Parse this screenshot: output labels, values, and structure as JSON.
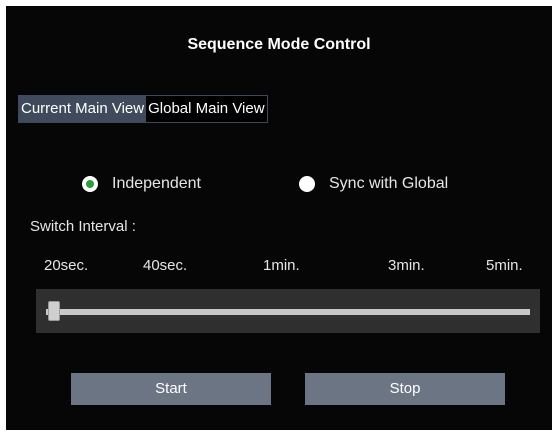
{
  "title": "Sequence Mode Control",
  "tabs": [
    {
      "label": "Current Main View",
      "active": true
    },
    {
      "label": "Global Main View",
      "active": false
    }
  ],
  "mode_options": [
    {
      "label": "Independent",
      "checked": true
    },
    {
      "label": "Sync with Global",
      "checked": false
    }
  ],
  "interval_label": "Switch Interval :",
  "interval_ticks": [
    "20sec.",
    "40sec.",
    "1min.",
    "3min.",
    "5min."
  ],
  "slider": {
    "selected_index": 0,
    "selected_value": "20sec."
  },
  "buttons": {
    "start": "Start",
    "stop": "Stop"
  },
  "colors": {
    "panel_bg": "#060606",
    "active_tab": "#3f4b5c",
    "button_bg": "#6b7584",
    "radio_accent": "#2d9c3c",
    "slider_box": "#2f2f2f"
  }
}
